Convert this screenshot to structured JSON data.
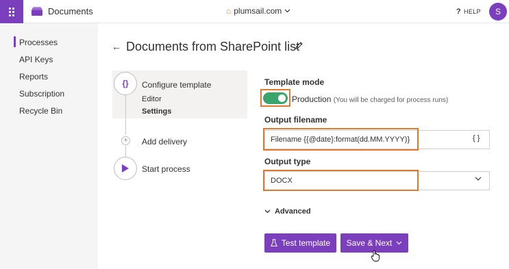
{
  "topbar": {
    "app_title": "Documents",
    "org_name": "plumsail.com",
    "help_label": "HELP",
    "help_glyph": "?",
    "avatar_initial": "S"
  },
  "sidebar": {
    "items": [
      {
        "label": "Processes",
        "active": true
      },
      {
        "label": "API Keys",
        "active": false
      },
      {
        "label": "Reports",
        "active": false
      },
      {
        "label": "Subscription",
        "active": false
      },
      {
        "label": "Recycle Bin",
        "active": false
      }
    ]
  },
  "page": {
    "title": "Documents from SharePoint list"
  },
  "steps": {
    "configure": {
      "label": "Configure template",
      "icon_text": "{}",
      "sub_items": [
        "Editor",
        "Settings"
      ]
    },
    "delivery": {
      "label": "Add delivery",
      "icon_text": "+"
    },
    "start": {
      "label": "Start process"
    }
  },
  "form": {
    "template_mode_label": "Template mode",
    "toggle_on": true,
    "production_label": "Production",
    "production_note": "(You will be charged for process runs)",
    "output_filename_label": "Output filename",
    "output_filename_value": "Filename {{@date}:format(dd.MM.YYYY)}",
    "braces_button": "{ }",
    "output_type_label": "Output type",
    "output_type_value": "DOCX",
    "advanced_label": "Advanced"
  },
  "buttons": {
    "test_template": "Test template",
    "save_next": "Save & Next"
  },
  "colors": {
    "accent": "#7b3fbe",
    "toggle_on": "#3aa56b",
    "highlight": "#e07a2e"
  }
}
